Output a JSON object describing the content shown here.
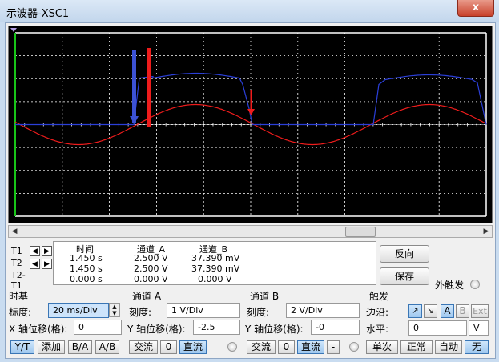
{
  "window": {
    "title": "示波器-XSC1",
    "close_glyph": "x"
  },
  "readout": {
    "row_labels": [
      "T1",
      "T2",
      "T2-T1"
    ],
    "headers": [
      "时间",
      "通道_A",
      "通道_B"
    ],
    "rows": [
      [
        "1.450 s",
        "2.500 V",
        "37.390 mV"
      ],
      [
        "1.450 s",
        "2.500 V",
        "37.390 mV"
      ],
      [
        "0.000 s",
        "0.000 V",
        "0.000 V"
      ]
    ]
  },
  "buttons": {
    "reverse": "反向",
    "save": "保存",
    "ext_trigger": "外触发"
  },
  "timebase": {
    "title": "时基",
    "scale_label": "标度:",
    "scale_value": "20 ms/Div",
    "xpos_label": "X 轴位移(格):",
    "xpos_value": "0",
    "modes": [
      "Y/T",
      "添加",
      "B/A",
      "A/B"
    ]
  },
  "channel_a": {
    "title": "通道 A",
    "scale_label": "刻度:",
    "scale_value": "1  V/Div",
    "ypos_label": "Y 轴位移(格):",
    "ypos_value": "-2.5",
    "couplings": [
      "交流",
      "0",
      "直流"
    ]
  },
  "channel_b": {
    "title": "通道 B",
    "scale_label": "刻度:",
    "scale_value": "2  V/Div",
    "ypos_label": "Y 轴位移(格):",
    "ypos_value": "-0",
    "couplings": [
      "交流",
      "0",
      "直流",
      "-"
    ]
  },
  "trigger": {
    "title": "触发",
    "edge_label": "边沿:",
    "level_label": "水平:",
    "level_value": "0",
    "level_unit": "V",
    "sources": [
      "A",
      "B",
      "Ext"
    ],
    "modes": [
      "单次",
      "正常",
      "自动",
      "无"
    ]
  },
  "colors": {
    "channel_a": "#ee1c1c",
    "channel_b": "#2b3fd8",
    "cursor_t2": "#3c52d4",
    "cursor_t1": "#ee1c1c"
  }
}
